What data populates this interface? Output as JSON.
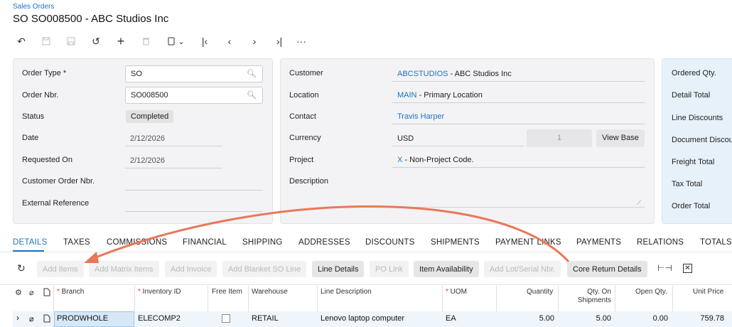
{
  "breadcrumb": "Sales Orders",
  "page_title": "SO SO008500 - ABC Studios Inc",
  "toolbar": {
    "icons": [
      "undo-icon",
      "save-close-icon",
      "save-icon",
      "revert-icon",
      "add-icon",
      "delete-icon",
      "copy-paste-icon",
      "first-record-icon",
      "previous-record-icon",
      "next-record-icon",
      "last-record-icon",
      "more-icon"
    ]
  },
  "summary_left": {
    "order_type_label": "Order Type *",
    "order_type_value": "SO",
    "order_nbr_label": "Order Nbr.",
    "order_nbr_value": "SO008500",
    "status_label": "Status",
    "status_value": "Completed",
    "date_label": "Date",
    "date_value": "2/12/2026",
    "requested_on_label": "Requested On",
    "requested_on_value": "2/12/2026",
    "customer_order_label": "Customer Order Nbr.",
    "customer_order_value": "",
    "external_ref_label": "External Reference",
    "external_ref_value": ""
  },
  "summary_mid": {
    "customer_label": "Customer",
    "customer_link": "ABCSTUDIOS",
    "customer_name": " - ABC Studios Inc",
    "location_label": "Location",
    "location_link": "MAIN",
    "location_name": " - Primary Location",
    "contact_label": "Contact",
    "contact_link": "Travis Harper",
    "currency_label": "Currency",
    "currency_value": "USD",
    "rate_value": "1",
    "view_base_label": "View Base",
    "project_label": "Project",
    "project_link": "X",
    "project_name": " - Non-Project Code.",
    "description_label": "Description",
    "description_value": ""
  },
  "summary_right": {
    "ordered_qty_label": "Ordered Qty.",
    "detail_total_label": "Detail Total",
    "line_discounts_label": "Line Discounts",
    "document_discount_label": "Document Discou",
    "freight_total_label": "Freight Total",
    "tax_total_label": "Tax Total",
    "order_total_label": "Order Total"
  },
  "tabs": [
    "DETAILS",
    "TAXES",
    "COMMISSIONS",
    "FINANCIAL",
    "SHIPPING",
    "ADDRESSES",
    "DISCOUNTS",
    "SHIPMENTS",
    "PAYMENT LINKS",
    "PAYMENTS",
    "RELATIONS",
    "TOTALS"
  ],
  "grid_toolbar": {
    "add_items": "Add Items",
    "add_matrix_items": "Add Matrix Items",
    "add_invoice": "Add Invoice",
    "add_blanket": "Add Blanket SO Line",
    "line_details": "Line Details",
    "po_link": "PO Link",
    "item_availability": "Item Availability",
    "add_lot_serial": "Add Lot/Serial Nbr.",
    "core_return": "Core Return Details"
  },
  "columns": {
    "branch": "Branch",
    "inventory_id": "Inventory ID",
    "free_item": "Free Item",
    "warehouse": "Warehouse",
    "line_description": "Line Description",
    "uom": "UOM",
    "quantity": "Quantity",
    "qty_on_shipments": "Qty. On Shipments",
    "open_qty": "Open Qty.",
    "unit_price": "Unit Price"
  },
  "row": {
    "branch": "PRODWHOLE",
    "inventory_id": "ELECOMP2",
    "warehouse": "RETAIL",
    "line_description": "Lenovo laptop computer",
    "uom": "EA",
    "quantity": "5.00",
    "qty_on_shipments": "5.00",
    "open_qty": "0.00",
    "unit_price": "759.78"
  },
  "colors": {
    "accent": "#1a73c9",
    "arrow": "#e8785a"
  }
}
